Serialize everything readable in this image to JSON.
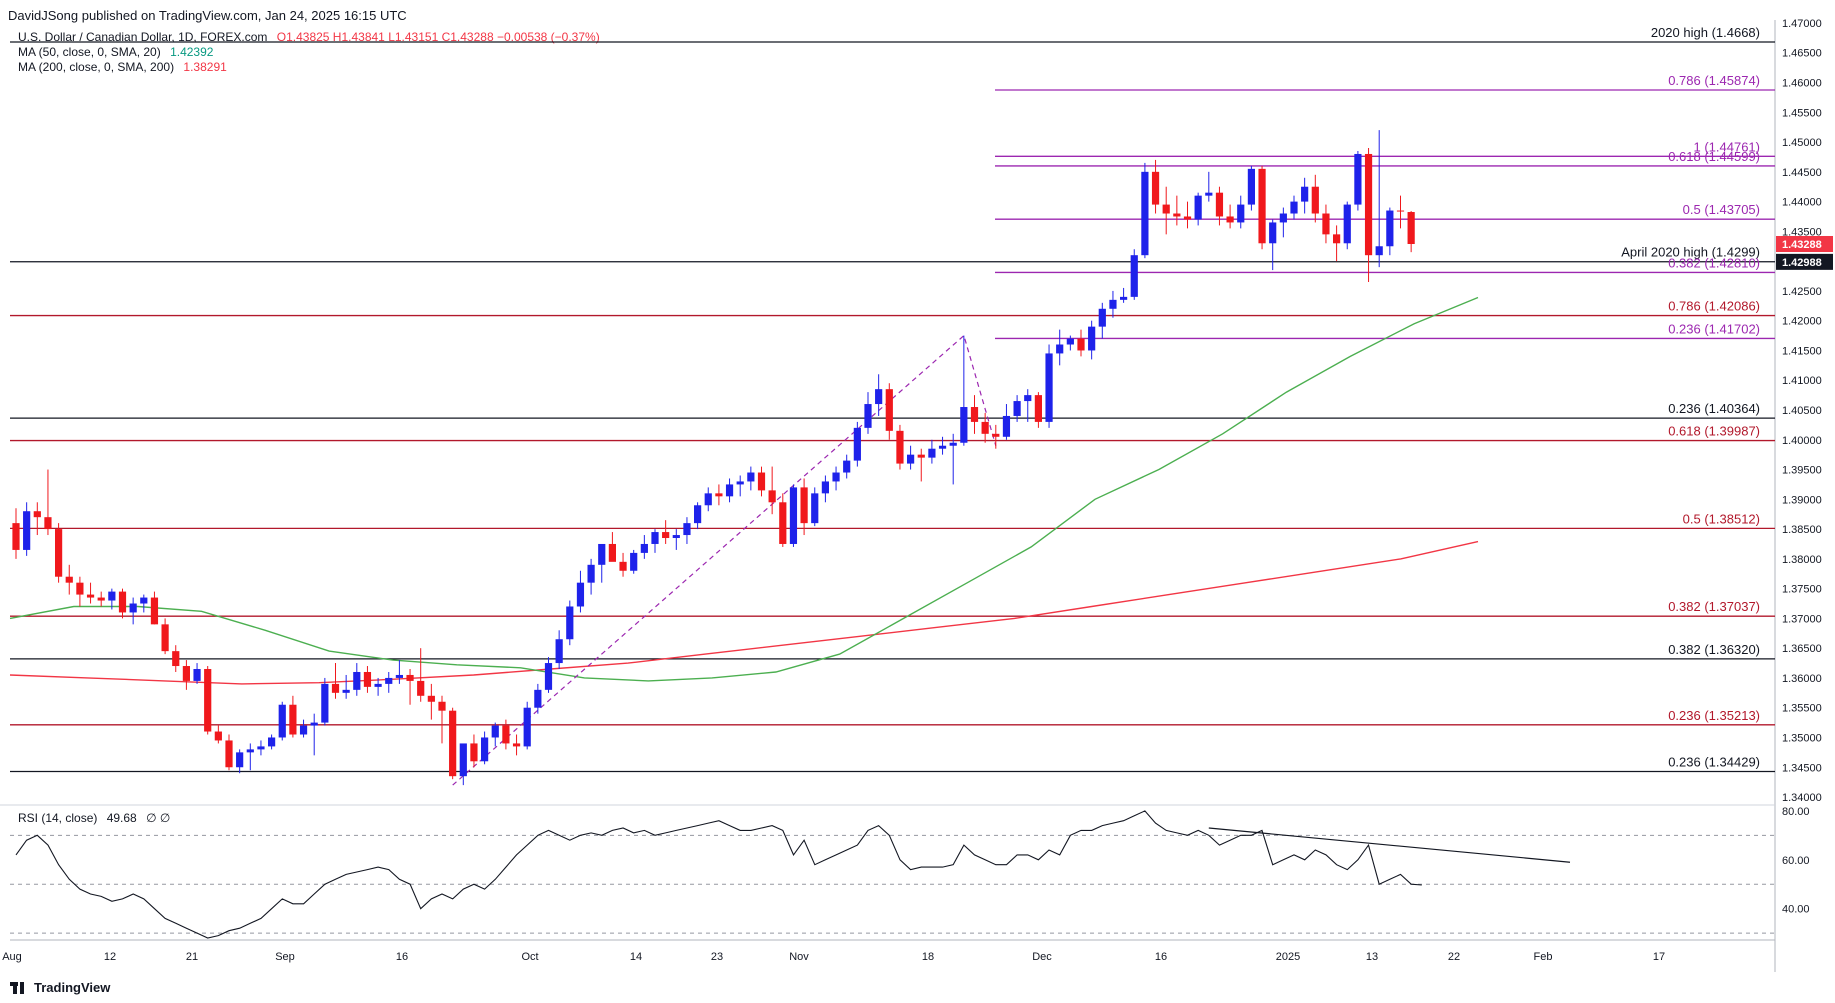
{
  "header": {
    "publish_line": "DavidJSong published on TradingView.com, Jan 24, 2025 16:15 UTC"
  },
  "legend": {
    "symbol": "U.S. Dollar / Canadian Dollar, 1D, FOREX.com",
    "ohlc": "O1.43825  H1.43841  L1.43151  C1.43288  −0.00538 (−0.37%)",
    "ma50_label": "MA (50, close, 0, SMA, 20)",
    "ma50_value": "1.42392",
    "ma200_label": "MA (200, close, 0, SMA, 200)",
    "ma200_value": "1.38291"
  },
  "rsi_legend": {
    "label": "RSI (14, close)",
    "value": "49.68",
    "extra": "∅ ∅"
  },
  "footer": {
    "brand": "TradingView"
  },
  "colors": {
    "bull": "#1e22ea",
    "bear": "#f0181c",
    "ma50": "#4caf50",
    "ma200": "#f23645",
    "rsi": "#131722",
    "fib_purple": "#9c27b0",
    "fib_red": "#b2182b"
  },
  "chart_data": {
    "type": "candlestick",
    "symbol": "USDCAD",
    "price_axis": {
      "ylim": [
        1.3395,
        1.4705
      ],
      "ticks": [
        "1.34000",
        "1.34500",
        "1.35000",
        "1.35500",
        "1.36000",
        "1.36500",
        "1.37000",
        "1.37500",
        "1.38000",
        "1.38500",
        "1.39000",
        "1.39500",
        "1.40000",
        "1.40500",
        "1.41000",
        "1.41500",
        "1.42000",
        "1.42500",
        "1.43000",
        "1.43500",
        "1.44000",
        "1.44500",
        "1.45000",
        "1.45500",
        "1.46000",
        "1.46500",
        "1.47000"
      ],
      "current_price_label": "1.43288",
      "reference_price_label": "1.42988"
    },
    "x_axis_labels": [
      "Aug",
      "12",
      "21",
      "Sep",
      "16",
      "Oct",
      "14",
      "23",
      "Nov",
      "18",
      "Dec",
      "16",
      "2025",
      "13",
      "22",
      "Feb",
      "17"
    ],
    "levels": [
      {
        "label": "2020 high (1.4668)",
        "value": 1.4668,
        "color": "#131722",
        "style": "black",
        "full": true
      },
      {
        "label": "0.786 (1.45874)",
        "value": 1.45874,
        "color": "#9c27b0",
        "style": "purple",
        "full": false
      },
      {
        "label": "1 (1.44761)",
        "value": 1.44761,
        "color": "#9c27b0",
        "style": "purple",
        "full": false
      },
      {
        "label": "0.618 (1.44599)",
        "value": 1.44599,
        "color": "#9c27b0",
        "style": "purple",
        "full": false
      },
      {
        "label": "0.5 (1.43705)",
        "value": 1.43705,
        "color": "#9c27b0",
        "style": "purple",
        "full": false
      },
      {
        "label": "April 2020 high (1.4299)",
        "value": 1.4299,
        "color": "#131722",
        "style": "black",
        "full": true
      },
      {
        "label": "0.382 (1.42810)",
        "value": 1.4281,
        "color": "#9c27b0",
        "style": "purple",
        "full": false
      },
      {
        "label": "0.786 (1.42086)",
        "value": 1.42086,
        "color": "#b2182b",
        "style": "red",
        "full": true
      },
      {
        "label": "0.236 (1.41702)",
        "value": 1.41702,
        "color": "#9c27b0",
        "style": "purple",
        "full": false
      },
      {
        "label": "0.236 (1.40364)",
        "value": 1.40364,
        "color": "#131722",
        "style": "black",
        "full": true
      },
      {
        "label": "0.618 (1.39987)",
        "value": 1.39987,
        "color": "#b2182b",
        "style": "red",
        "full": true
      },
      {
        "label": "0.5 (1.38512)",
        "value": 1.38512,
        "color": "#b2182b",
        "style": "red",
        "full": true
      },
      {
        "label": "0.382 (1.37037)",
        "value": 1.37037,
        "color": "#b2182b",
        "style": "red",
        "full": true
      },
      {
        "label": "0.382 (1.36320)",
        "value": 1.3632,
        "color": "#131722",
        "style": "black",
        "full": true
      },
      {
        "label": "0.236 (1.35213)",
        "value": 1.35213,
        "color": "#b2182b",
        "style": "red",
        "full": true
      },
      {
        "label": "0.236 (1.34429)",
        "value": 1.34429,
        "color": "#131722",
        "style": "black",
        "full": true
      }
    ],
    "candles": [
      [
        1.386,
        1.3885,
        1.38,
        1.3815
      ],
      [
        1.3815,
        1.3895,
        1.3805,
        1.388
      ],
      [
        1.388,
        1.3895,
        1.384,
        1.387
      ],
      [
        1.387,
        1.395,
        1.384,
        1.385
      ],
      [
        1.385,
        1.386,
        1.376,
        1.377
      ],
      [
        1.377,
        1.379,
        1.374,
        1.376
      ],
      [
        1.376,
        1.377,
        1.372,
        1.374
      ],
      [
        1.374,
        1.376,
        1.3725,
        1.3735
      ],
      [
        1.3735,
        1.3745,
        1.372,
        1.373
      ],
      [
        1.373,
        1.375,
        1.3715,
        1.3745
      ],
      [
        1.3745,
        1.375,
        1.37,
        1.371
      ],
      [
        1.371,
        1.3735,
        1.369,
        1.3725
      ],
      [
        1.3725,
        1.374,
        1.371,
        1.3735
      ],
      [
        1.3735,
        1.3745,
        1.369,
        1.369
      ],
      [
        1.369,
        1.37,
        1.364,
        1.3645
      ],
      [
        1.3645,
        1.3655,
        1.361,
        1.362
      ],
      [
        1.362,
        1.363,
        1.358,
        1.3595
      ],
      [
        1.3595,
        1.3625,
        1.359,
        1.3615
      ],
      [
        1.3615,
        1.362,
        1.3505,
        1.351
      ],
      [
        1.351,
        1.352,
        1.349,
        1.3495
      ],
      [
        1.3495,
        1.3505,
        1.3445,
        1.345
      ],
      [
        1.345,
        1.348,
        1.344,
        1.3475
      ],
      [
        1.3475,
        1.349,
        1.3445,
        1.348
      ],
      [
        1.348,
        1.3495,
        1.347,
        1.3485
      ],
      [
        1.3485,
        1.3505,
        1.348,
        1.35
      ],
      [
        1.35,
        1.356,
        1.3495,
        1.3555
      ],
      [
        1.3555,
        1.357,
        1.35,
        1.3505
      ],
      [
        1.3505,
        1.353,
        1.35,
        1.352
      ],
      [
        1.352,
        1.354,
        1.347,
        1.3525
      ],
      [
        1.3525,
        1.36,
        1.352,
        1.359
      ],
      [
        1.359,
        1.3625,
        1.3565,
        1.3575
      ],
      [
        1.3575,
        1.3605,
        1.3565,
        1.358
      ],
      [
        1.358,
        1.3625,
        1.357,
        1.361
      ],
      [
        1.361,
        1.362,
        1.3575,
        1.3585
      ],
      [
        1.3585,
        1.36,
        1.357,
        1.359
      ],
      [
        1.359,
        1.361,
        1.3575,
        1.36
      ],
      [
        1.36,
        1.363,
        1.359,
        1.3605
      ],
      [
        1.3605,
        1.3615,
        1.3555,
        1.3595
      ],
      [
        1.3595,
        1.365,
        1.356,
        1.357
      ],
      [
        1.357,
        1.359,
        1.353,
        1.356
      ],
      [
        1.356,
        1.357,
        1.349,
        1.3545
      ],
      [
        1.3545,
        1.355,
        1.343,
        1.3435
      ],
      [
        1.3435,
        1.345,
        1.342,
        1.349
      ],
      [
        1.349,
        1.3505,
        1.345,
        1.346
      ],
      [
        1.346,
        1.351,
        1.3455,
        1.35
      ],
      [
        1.35,
        1.3525,
        1.3485,
        1.352
      ],
      [
        1.352,
        1.353,
        1.348,
        1.349
      ],
      [
        1.349,
        1.3505,
        1.347,
        1.3485
      ],
      [
        1.3485,
        1.356,
        1.348,
        1.355
      ],
      [
        1.355,
        1.359,
        1.354,
        1.358
      ],
      [
        1.358,
        1.3635,
        1.3575,
        1.3625
      ],
      [
        1.3625,
        1.368,
        1.3615,
        1.3665
      ],
      [
        1.3665,
        1.373,
        1.3655,
        1.372
      ],
      [
        1.372,
        1.378,
        1.371,
        1.376
      ],
      [
        1.376,
        1.38,
        1.374,
        1.379
      ],
      [
        1.379,
        1.382,
        1.376,
        1.3825
      ],
      [
        1.3825,
        1.3845,
        1.38,
        1.3795
      ],
      [
        1.3795,
        1.381,
        1.377,
        1.378
      ],
      [
        1.378,
        1.3815,
        1.3775,
        1.381
      ],
      [
        1.381,
        1.384,
        1.38,
        1.3825
      ],
      [
        1.3825,
        1.385,
        1.381,
        1.3845
      ],
      [
        1.3845,
        1.3865,
        1.3825,
        1.3835
      ],
      [
        1.3835,
        1.385,
        1.3815,
        1.384
      ],
      [
        1.384,
        1.387,
        1.3825,
        1.386
      ],
      [
        1.386,
        1.3895,
        1.385,
        1.389
      ],
      [
        1.389,
        1.392,
        1.388,
        1.391
      ],
      [
        1.391,
        1.3925,
        1.389,
        1.3905
      ],
      [
        1.3905,
        1.3935,
        1.3895,
        1.3925
      ],
      [
        1.3925,
        1.394,
        1.3905,
        1.393
      ],
      [
        1.393,
        1.3955,
        1.3915,
        1.3945
      ],
      [
        1.3945,
        1.3955,
        1.3905,
        1.3915
      ],
      [
        1.3915,
        1.3955,
        1.3875,
        1.3895
      ],
      [
        1.3895,
        1.391,
        1.382,
        1.3825
      ],
      [
        1.3825,
        1.3925,
        1.382,
        1.392
      ],
      [
        1.392,
        1.3935,
        1.384,
        1.386
      ],
      [
        1.386,
        1.392,
        1.3855,
        1.391
      ],
      [
        1.391,
        1.394,
        1.3895,
        1.393
      ],
      [
        1.393,
        1.3955,
        1.3915,
        1.3945
      ],
      [
        1.3945,
        1.3975,
        1.3935,
        1.3965
      ],
      [
        1.3965,
        1.403,
        1.3955,
        1.402
      ],
      [
        1.402,
        1.408,
        1.401,
        1.406
      ],
      [
        1.406,
        1.411,
        1.404,
        1.4085
      ],
      [
        1.4085,
        1.4095,
        1.4,
        1.4015
      ],
      [
        1.4015,
        1.4025,
        1.395,
        1.396
      ],
      [
        1.396,
        1.399,
        1.395,
        1.3975
      ],
      [
        1.3975,
        1.3985,
        1.393,
        1.397
      ],
      [
        1.397,
        1.4,
        1.396,
        1.3985
      ],
      [
        1.3985,
        1.4005,
        1.3975,
        1.399
      ],
      [
        1.399,
        1.401,
        1.3925,
        1.3995
      ],
      [
        1.3995,
        1.4175,
        1.399,
        1.4055
      ],
      [
        1.4055,
        1.4075,
        1.401,
        1.403
      ],
      [
        1.403,
        1.4045,
        1.3995,
        1.401
      ],
      [
        1.401,
        1.4025,
        1.3985,
        1.4005
      ],
      [
        1.4005,
        1.406,
        1.4,
        1.404
      ],
      [
        1.404,
        1.4075,
        1.403,
        1.4065
      ],
      [
        1.4065,
        1.4085,
        1.403,
        1.4075
      ],
      [
        1.4075,
        1.408,
        1.402,
        1.403
      ],
      [
        1.403,
        1.416,
        1.402,
        1.4145
      ],
      [
        1.4145,
        1.4185,
        1.4125,
        1.416
      ],
      [
        1.416,
        1.4175,
        1.415,
        1.417
      ],
      [
        1.417,
        1.4185,
        1.414,
        1.415
      ],
      [
        1.415,
        1.42,
        1.4135,
        1.419
      ],
      [
        1.419,
        1.423,
        1.417,
        1.422
      ],
      [
        1.422,
        1.425,
        1.4205,
        1.4235
      ],
      [
        1.4235,
        1.4255,
        1.423,
        1.424
      ],
      [
        1.424,
        1.432,
        1.4235,
        1.431
      ],
      [
        1.431,
        1.4465,
        1.4305,
        1.445
      ],
      [
        1.445,
        1.447,
        1.438,
        1.4395
      ],
      [
        1.4395,
        1.4425,
        1.4345,
        1.438
      ],
      [
        1.438,
        1.441,
        1.436,
        1.4375
      ],
      [
        1.4375,
        1.44,
        1.4355,
        1.437
      ],
      [
        1.437,
        1.4415,
        1.436,
        1.441
      ],
      [
        1.441,
        1.445,
        1.44,
        1.4415
      ],
      [
        1.4415,
        1.4425,
        1.436,
        1.4375
      ],
      [
        1.4375,
        1.4395,
        1.4355,
        1.4365
      ],
      [
        1.4365,
        1.441,
        1.4355,
        1.4395
      ],
      [
        1.4395,
        1.446,
        1.4385,
        1.4455
      ],
      [
        1.4455,
        1.446,
        1.432,
        1.433
      ],
      [
        1.433,
        1.437,
        1.4285,
        1.4365
      ],
      [
        1.4365,
        1.439,
        1.434,
        1.438
      ],
      [
        1.438,
        1.441,
        1.437,
        1.44
      ],
      [
        1.44,
        1.444,
        1.438,
        1.4425
      ],
      [
        1.4425,
        1.4445,
        1.4365,
        1.438
      ],
      [
        1.438,
        1.4395,
        1.433,
        1.4345
      ],
      [
        1.4345,
        1.436,
        1.43,
        1.433
      ],
      [
        1.433,
        1.44,
        1.432,
        1.4395
      ],
      [
        1.4395,
        1.4485,
        1.4385,
        1.448
      ],
      [
        1.448,
        1.449,
        1.4265,
        1.431
      ],
      [
        1.431,
        1.452,
        1.429,
        1.4325
      ],
      [
        1.4325,
        1.439,
        1.431,
        1.4385
      ],
      [
        1.4385,
        1.441,
        1.4355,
        1.4384
      ],
      [
        1.43825,
        1.43841,
        1.43151,
        1.43288
      ]
    ],
    "ma50": {
      "name": "MA (50, close, 0, SMA, 20)",
      "values": [
        1.37,
        1.372,
        1.372,
        1.3712,
        1.368,
        1.3645,
        1.363,
        1.3622,
        1.3617,
        1.36,
        1.3595,
        1.36,
        1.361,
        1.364,
        1.37,
        1.376,
        1.382,
        1.39,
        1.395,
        1.401,
        1.408,
        1.414,
        1.4195,
        1.4239
      ]
    },
    "ma200": {
      "name": "MA (200, close, 0, SMA, 200)",
      "values": [
        1.3605,
        1.36,
        1.3595,
        1.359,
        1.3592,
        1.3598,
        1.3605,
        1.3615,
        1.3625,
        1.364,
        1.3655,
        1.367,
        1.3685,
        1.37,
        1.372,
        1.374,
        1.376,
        1.378,
        1.38,
        1.3829
      ]
    },
    "rsi": {
      "name": "RSI (14, close)",
      "ylim": [
        28,
        82
      ],
      "ticks": [
        "40.00",
        "60.00",
        "80.00"
      ],
      "levels": [
        30,
        50,
        70
      ],
      "values": [
        62,
        68,
        70,
        66,
        58,
        52,
        48,
        46,
        45,
        43,
        44,
        46,
        44,
        40,
        36,
        34,
        32,
        30,
        28,
        29,
        31,
        32,
        34,
        36,
        40,
        44,
        42,
        42,
        46,
        50,
        52,
        54,
        55,
        56,
        57,
        56,
        52,
        50,
        40,
        44,
        46,
        44,
        48,
        50,
        48,
        52,
        57,
        62,
        66,
        70,
        72,
        70,
        68,
        70,
        71,
        70,
        72,
        73,
        71,
        72,
        70,
        71,
        72,
        73,
        74,
        75,
        76,
        74,
        72,
        72,
        73,
        74,
        72,
        62,
        68,
        58,
        60,
        62,
        64,
        66,
        72,
        74,
        70,
        60,
        56,
        57,
        57,
        57,
        58,
        66,
        62,
        60,
        58,
        58,
        62,
        62,
        60,
        64,
        62,
        70,
        72,
        72,
        74,
        75,
        76,
        78,
        80,
        75,
        72,
        71,
        70,
        72,
        70,
        66,
        68,
        70,
        70,
        72,
        58,
        60,
        62,
        60,
        64,
        62,
        58,
        56,
        60,
        66,
        50,
        52,
        54,
        50,
        49.68
      ]
    }
  }
}
